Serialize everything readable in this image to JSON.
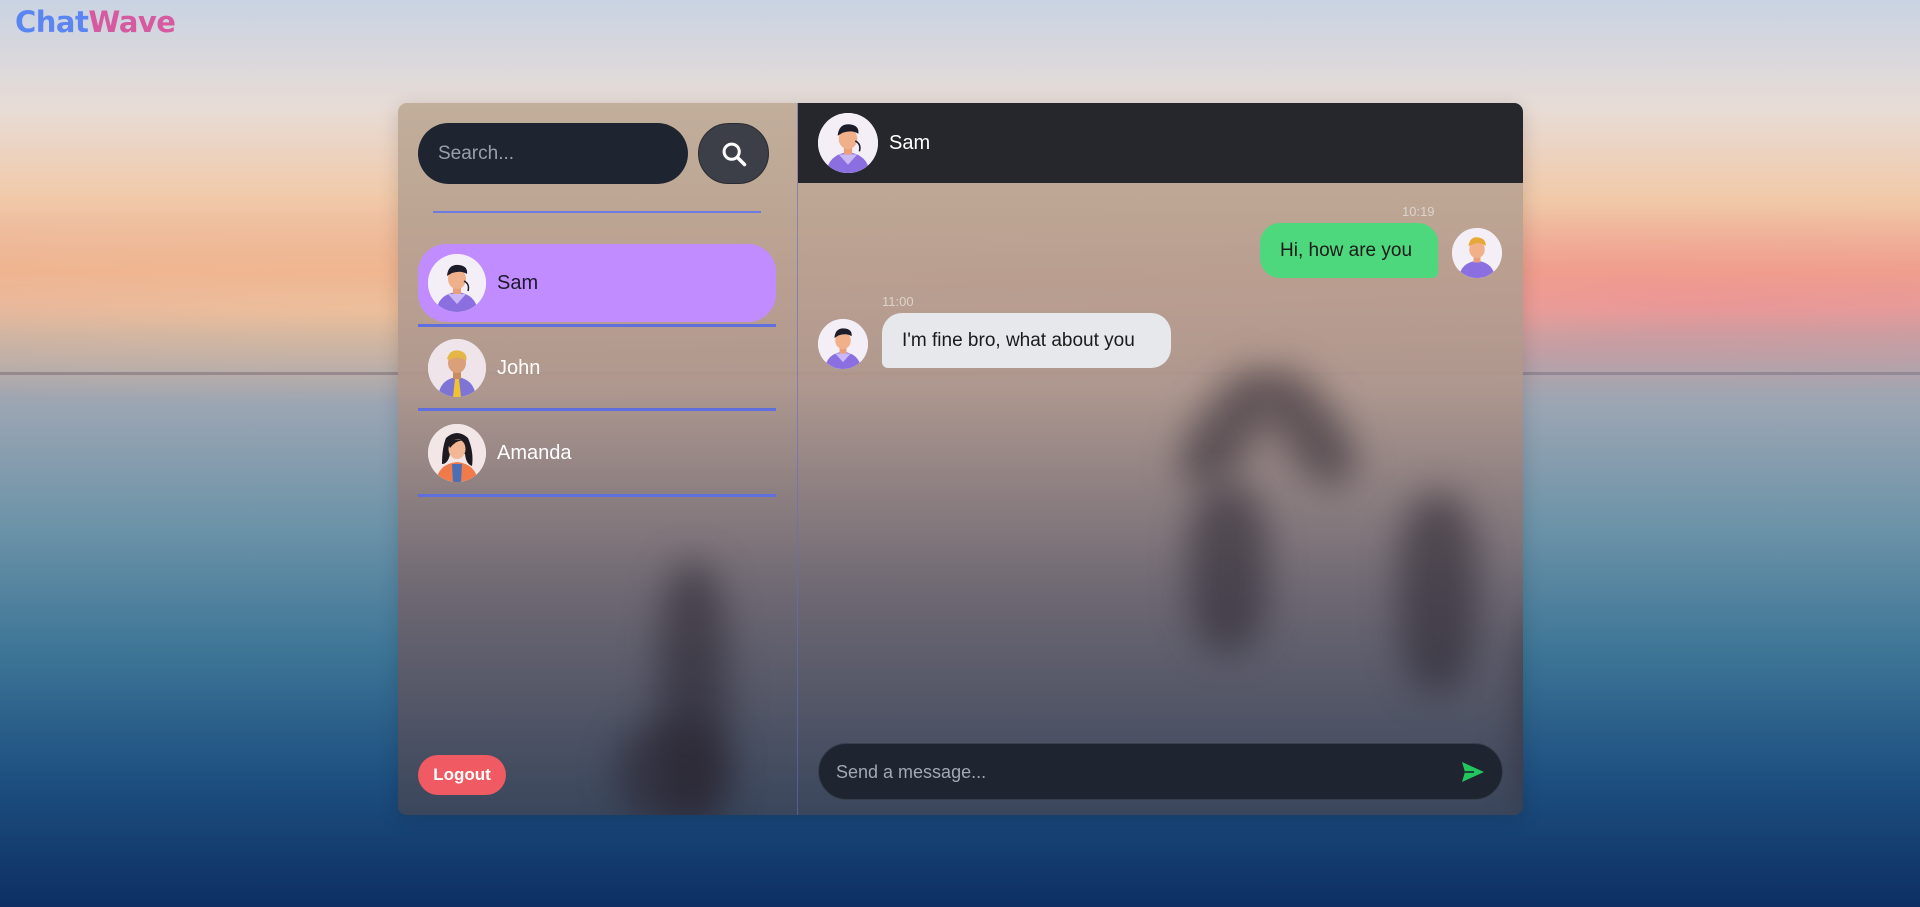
{
  "brand": {
    "part1": "Chat",
    "part2": "Wave"
  },
  "search": {
    "placeholder": "Search..."
  },
  "contacts": [
    {
      "name": "Sam",
      "active": true
    },
    {
      "name": "John",
      "active": false
    },
    {
      "name": "Amanda",
      "active": false
    }
  ],
  "logout_label": "Logout",
  "chat": {
    "header_name": "Sam",
    "messages": [
      {
        "direction": "out",
        "time": "10:19",
        "text": "Hi, how are you"
      },
      {
        "direction": "in",
        "time": "11:00",
        "text": "I'm fine bro, what about you"
      }
    ],
    "composer_placeholder": "Send a message..."
  },
  "colors": {
    "active_contact": "#c18cff",
    "divider": "#5f6fde",
    "outgoing_bubble": "#4ed87d",
    "incoming_bubble": "#e7e8ec",
    "logout": "#ef5a63",
    "send_icon": "#22c55e"
  }
}
